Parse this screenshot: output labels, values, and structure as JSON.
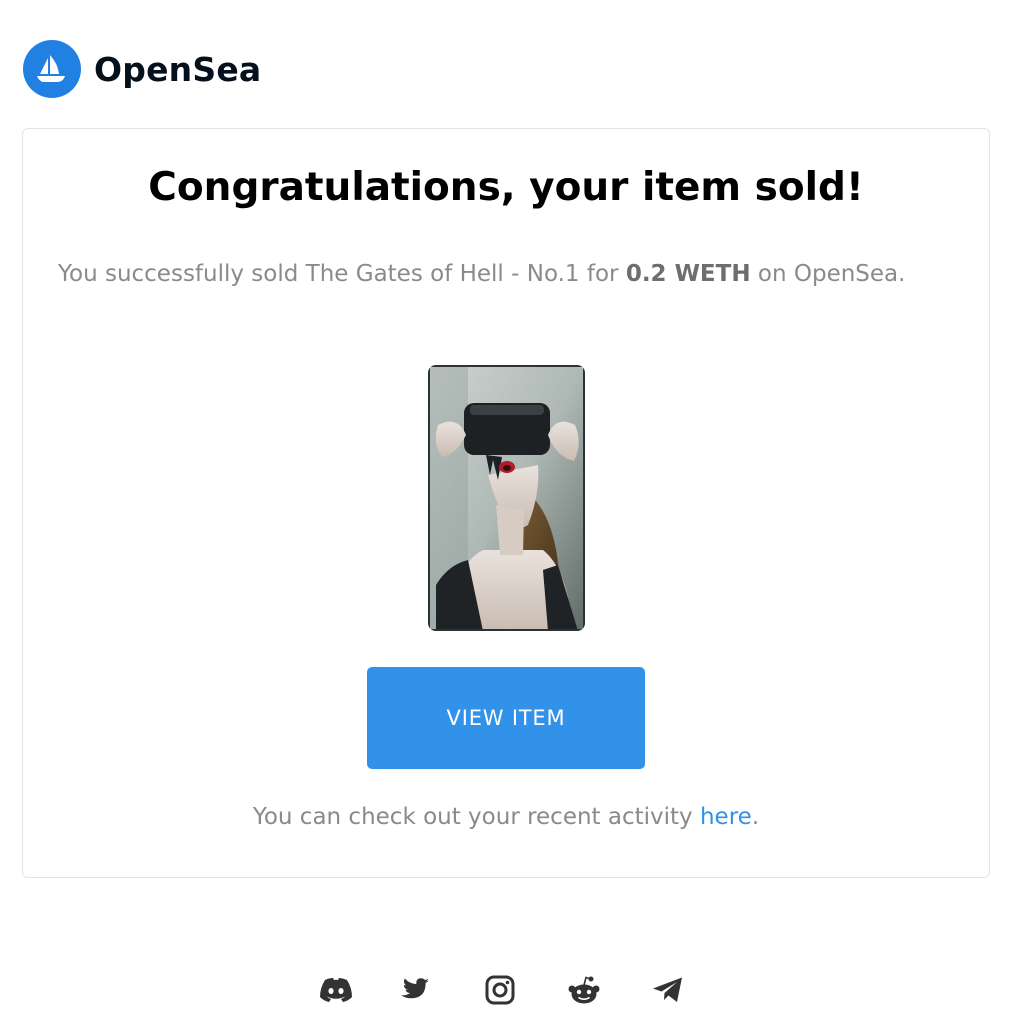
{
  "brand": {
    "name": "OpenSea",
    "accent_color": "#2081e2"
  },
  "card": {
    "title": "Congratulations, your item sold!",
    "message": {
      "prefix": "You successfully sold The Gates of Hell - No.1 for ",
      "price": "0.2 WETH",
      "suffix": " on OpenSea."
    },
    "item_image": "nft-artwork-vr-headset-portrait",
    "button_label": "VIEW ITEM",
    "button_color": "#3291e9",
    "activity": {
      "prefix": "You can check out your recent activity ",
      "link_label": "here",
      "suffix": "."
    }
  },
  "footer": {
    "social_icons": [
      "discord-icon",
      "twitter-icon",
      "instagram-icon",
      "reddit-icon",
      "telegram-icon"
    ]
  }
}
